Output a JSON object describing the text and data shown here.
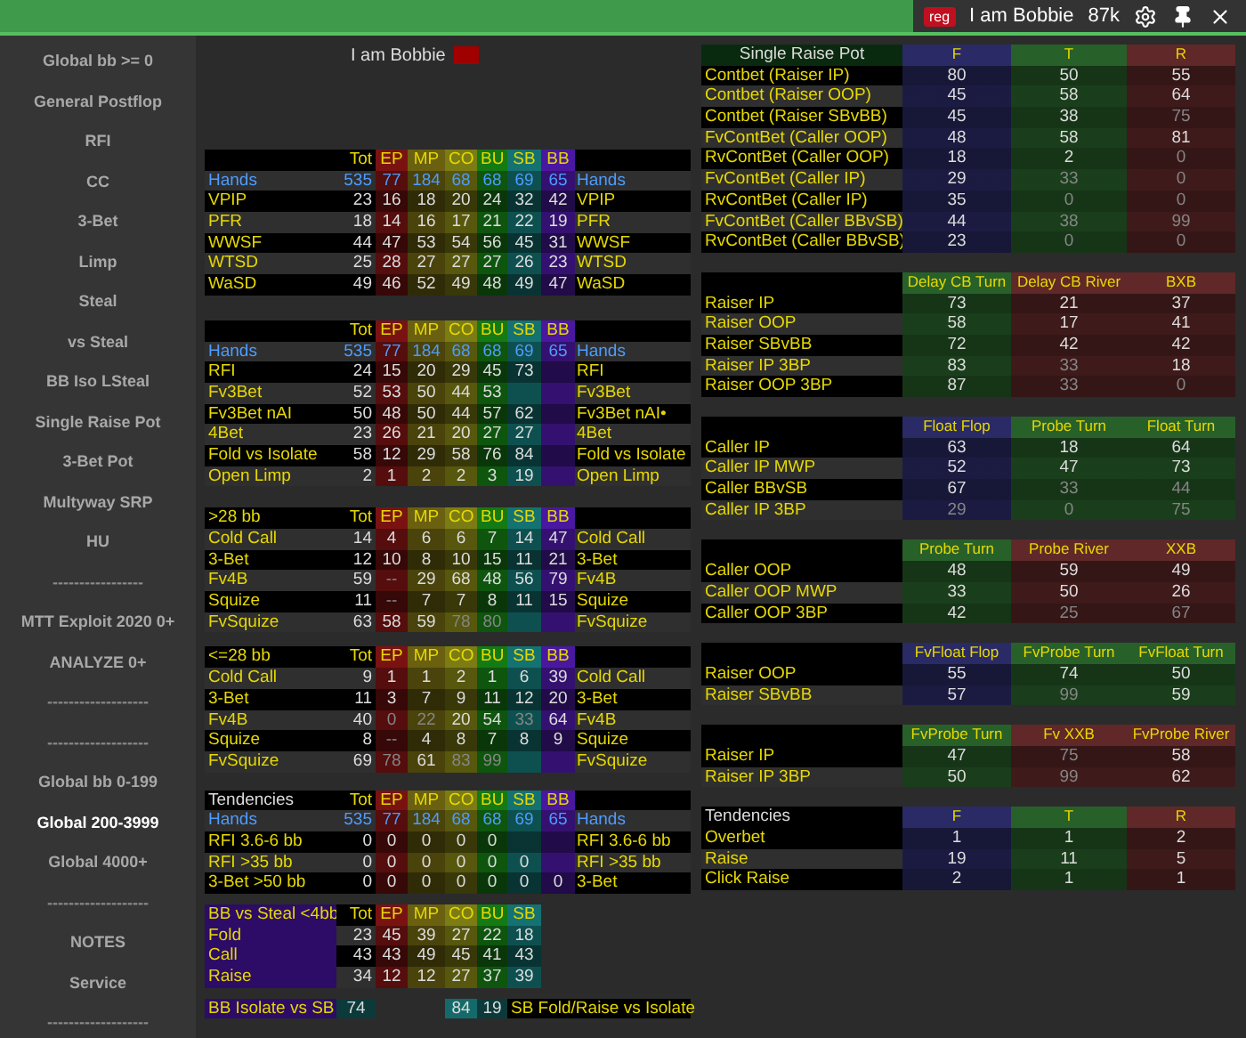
{
  "top_bar": {
    "badge": "reg",
    "user": "I am Bobbie",
    "count": "87k"
  },
  "sidebar": {
    "items": [
      {
        "label": "Global bb >= 0",
        "kind": "link",
        "selected": false
      },
      {
        "label": "General Postflop",
        "kind": "link",
        "selected": false
      },
      {
        "label": "RFI",
        "kind": "link",
        "selected": false
      },
      {
        "label": "CC",
        "kind": "link",
        "selected": false
      },
      {
        "label": "3-Bet",
        "kind": "link",
        "selected": false
      },
      {
        "label": "Limp",
        "kind": "link",
        "selected": false
      },
      {
        "label": "Steal",
        "kind": "link",
        "selected": false
      },
      {
        "label": "vs Steal",
        "kind": "link",
        "selected": false
      },
      {
        "label": "BB Iso LSteal",
        "kind": "link",
        "selected": false
      },
      {
        "label": "Single Raise Pot",
        "kind": "link",
        "selected": false
      },
      {
        "label": "3-Bet Pot",
        "kind": "link",
        "selected": false
      },
      {
        "label": "Multyway SRP",
        "kind": "link",
        "selected": false
      },
      {
        "label": "HU",
        "kind": "link",
        "selected": false
      },
      {
        "label": "-----------------",
        "kind": "divider",
        "selected": false
      },
      {
        "label": "MTT Exploit 2020 0+",
        "kind": "link",
        "selected": false
      },
      {
        "label": "ANALYZE 0+",
        "kind": "link",
        "selected": false
      },
      {
        "label": "-------------------",
        "kind": "divider",
        "selected": false
      },
      {
        "label": "-------------------",
        "kind": "divider",
        "selected": false
      },
      {
        "label": "Global bb 0-199",
        "kind": "link",
        "selected": false
      },
      {
        "label": "Global 200-3999",
        "kind": "link",
        "selected": true
      },
      {
        "label": "Global 4000+",
        "kind": "link",
        "selected": false
      },
      {
        "label": "-------------------",
        "kind": "divider",
        "selected": false
      },
      {
        "label": "NOTES",
        "kind": "link",
        "selected": false
      },
      {
        "label": "Service",
        "kind": "link",
        "selected": false
      },
      {
        "label": "-------------------",
        "kind": "divider",
        "selected": false
      }
    ]
  },
  "player_title": "I am Bobbie",
  "left_tables": [
    {
      "kind": "stats",
      "columns": [
        {
          "name": "Tot"
        },
        {
          "name": "EP",
          "color": "#7a1212"
        },
        {
          "name": "MP",
          "color": "#6a6010"
        },
        {
          "name": "CO",
          "color": "#7c7c14"
        },
        {
          "name": "BU",
          "color": "#147a14"
        },
        {
          "name": "SB",
          "color": "#147272"
        },
        {
          "name": "BB",
          "color": "#4a18a0"
        }
      ],
      "rows": [
        {
          "label": "Hands",
          "kind": "hands",
          "values": [
            "535",
            "77",
            "184",
            "68",
            "68",
            "69",
            "65"
          ],
          "right_label": "Hands"
        },
        {
          "label": "VPIP",
          "values": [
            "23",
            "16",
            "18",
            "20",
            "24",
            "32",
            "42"
          ],
          "right_label": "VPIP"
        },
        {
          "label": "PFR",
          "values": [
            "18",
            "14",
            "16",
            "17",
            "21",
            "22",
            "19"
          ],
          "right_label": "PFR"
        },
        {
          "label": "WWSF",
          "values": [
            "44",
            "47",
            "53",
            "54",
            "56",
            "45",
            "31"
          ],
          "right_label": "WWSF"
        },
        {
          "label": "WTSD",
          "values": [
            "25",
            "28",
            "27",
            "27",
            "27",
            "26",
            "23"
          ],
          "right_label": "WTSD"
        },
        {
          "label": "WaSD",
          "values": [
            "49",
            "46",
            "52",
            "49",
            "48",
            "49",
            "47"
          ],
          "right_label": "WaSD"
        }
      ]
    },
    {
      "kind": "stats",
      "columns": [
        {
          "name": "Tot"
        },
        {
          "name": "EP",
          "color": "#7a1212"
        },
        {
          "name": "MP",
          "color": "#6a6010"
        },
        {
          "name": "CO",
          "color": "#7c7c14"
        },
        {
          "name": "BU",
          "color": "#147a14"
        },
        {
          "name": "SB",
          "color": "#147272"
        },
        {
          "name": "BB",
          "color": "#4a18a0"
        }
      ],
      "rows": [
        {
          "label": "Hands",
          "kind": "hands",
          "values": [
            "535",
            "77",
            "184",
            "68",
            "68",
            "69",
            "65"
          ],
          "right_label": "Hands"
        },
        {
          "label": "RFI",
          "values": [
            "24",
            "15",
            "20",
            "29",
            "45",
            "73"
          ],
          "right_label": "RFI"
        },
        {
          "label": "Fv3Bet",
          "values": [
            "52",
            "53",
            "50",
            "44",
            "53"
          ],
          "right_label": "Fv3Bet"
        },
        {
          "label": "Fv3Bet nAI",
          "values": [
            "50",
            "48",
            "50",
            "44",
            "57",
            "62"
          ],
          "right_label": "Fv3Bet nAI•"
        },
        {
          "label": "4Bet",
          "values": [
            "23",
            "26",
            "21",
            "20",
            "27",
            "27"
          ],
          "right_label": "4Bet"
        },
        {
          "label": "Fold vs Isolate",
          "values": [
            "58",
            "12",
            "29",
            "58",
            "76",
            "84"
          ],
          "right_label": "Fold vs Isolate"
        },
        {
          "label": "Open Limp",
          "values": [
            "2",
            "1",
            "2",
            "2",
            "3",
            "19"
          ],
          "right_label": "Open Limp"
        }
      ]
    },
    {
      "kind": "stats",
      "title": ">28 bb",
      "columns": [
        {
          "name": "Tot"
        },
        {
          "name": "EP",
          "color": "#7a1212"
        },
        {
          "name": "MP",
          "color": "#6a6010"
        },
        {
          "name": "CO",
          "color": "#7c7c14"
        },
        {
          "name": "BU",
          "color": "#147a14"
        },
        {
          "name": "SB",
          "color": "#147272"
        },
        {
          "name": "BB",
          "color": "#4a18a0"
        }
      ],
      "rows": [
        {
          "label": "Cold Call",
          "values": [
            "14",
            "4",
            "6",
            "6",
            "7",
            "14",
            "47"
          ],
          "right_label": "Cold Call"
        },
        {
          "label": "3-Bet",
          "values": [
            "12",
            "10",
            "8",
            "10",
            "15",
            "11",
            "21"
          ],
          "right_label": "3-Bet"
        },
        {
          "label": "Fv4B",
          "values": [
            "59",
            "--",
            "29",
            "68",
            "48",
            "56",
            "79"
          ],
          "right_label": "Fv4B",
          "dimmed": [
            false,
            true,
            false,
            false,
            false,
            false,
            false
          ]
        },
        {
          "label": "Squize",
          "values": [
            "11",
            "--",
            "7",
            "7",
            "8",
            "11",
            "15"
          ],
          "right_label": "Squize",
          "dimmed": [
            false,
            true,
            false,
            false,
            false,
            false,
            false
          ]
        },
        {
          "label": "FvSquize",
          "values": [
            "63",
            "58",
            "59",
            "78",
            "80"
          ],
          "right_label": "FvSquize",
          "dimmed": [
            false,
            false,
            false,
            true,
            true
          ]
        }
      ]
    },
    {
      "kind": "stats",
      "title": "<=28 bb",
      "columns": [
        {
          "name": "Tot"
        },
        {
          "name": "EP",
          "color": "#7a1212"
        },
        {
          "name": "MP",
          "color": "#6a6010"
        },
        {
          "name": "CO",
          "color": "#7c7c14"
        },
        {
          "name": "BU",
          "color": "#147a14"
        },
        {
          "name": "SB",
          "color": "#147272"
        },
        {
          "name": "BB",
          "color": "#4a18a0"
        }
      ],
      "rows": [
        {
          "label": "Cold Call",
          "values": [
            "9",
            "1",
            "1",
            "2",
            "1",
            "6",
            "39"
          ],
          "right_label": "Cold Call"
        },
        {
          "label": "3-Bet",
          "values": [
            "11",
            "3",
            "7",
            "9",
            "11",
            "12",
            "20"
          ],
          "right_label": "3-Bet"
        },
        {
          "label": "Fv4B",
          "values": [
            "40",
            "0",
            "22",
            "20",
            "54",
            "33",
            "64"
          ],
          "right_label": "Fv4B",
          "dimmed": [
            false,
            true,
            true,
            false,
            false,
            true,
            false
          ]
        },
        {
          "label": "Squize",
          "values": [
            "8",
            "--",
            "4",
            "8",
            "7",
            "8",
            "9"
          ],
          "right_label": "Squize",
          "dimmed": [
            false,
            true,
            false,
            false,
            false,
            false,
            false
          ]
        },
        {
          "label": "FvSquize",
          "values": [
            "69",
            "78",
            "61",
            "83",
            "99"
          ],
          "right_label": "FvSquize",
          "dimmed": [
            false,
            true,
            false,
            true,
            true
          ]
        }
      ]
    },
    {
      "kind": "tendencies",
      "title": "Tendencies",
      "columns": [
        {
          "name": "Tot"
        },
        {
          "name": "EP",
          "color": "#7a1212"
        },
        {
          "name": "MP",
          "color": "#6a6010"
        },
        {
          "name": "CO",
          "color": "#7c7c14"
        },
        {
          "name": "BU",
          "color": "#147a14"
        },
        {
          "name": "SB",
          "color": "#147272"
        },
        {
          "name": "BB",
          "color": "#4a18a0"
        }
      ],
      "rows": [
        {
          "label": "Hands",
          "kind": "hands",
          "values": [
            "535",
            "77",
            "184",
            "68",
            "68",
            "69",
            "65"
          ],
          "right_label": "Hands"
        },
        {
          "label": "RFI 3.6-6 bb",
          "values": [
            "0",
            "0",
            "0",
            "0",
            "0"
          ],
          "right_label": "RFI 3.6-6 bb"
        },
        {
          "label": "RFI >35 bb",
          "values": [
            "0",
            "0",
            "0",
            "0",
            "0",
            "0"
          ],
          "right_label": "RFI >35 bb"
        },
        {
          "label": "3-Bet >50 bb",
          "values": [
            "0",
            "0",
            "0",
            "0",
            "0",
            "0",
            "0"
          ],
          "right_label": "3-Bet"
        }
      ]
    },
    {
      "kind": "steal",
      "title": "BB vs Steal <4bb",
      "columns": [
        {
          "name": "Tot"
        },
        {
          "name": "EP",
          "color": "#7a1212"
        },
        {
          "name": "MP",
          "color": "#6a6010"
        },
        {
          "name": "CO",
          "color": "#7c7c14"
        },
        {
          "name": "BU",
          "color": "#147a14"
        },
        {
          "name": "SB",
          "color": "#147272"
        }
      ],
      "rows": [
        {
          "label": "Fold",
          "values": [
            "23",
            "45",
            "39",
            "27",
            "22",
            "18"
          ]
        },
        {
          "label": "Call",
          "values": [
            "43",
            "43",
            "49",
            "45",
            "41",
            "43"
          ]
        },
        {
          "label": "Raise",
          "values": [
            "34",
            "12",
            "12",
            "27",
            "37",
            "39"
          ]
        }
      ]
    }
  ],
  "isolate_row": {
    "bb_label": "BB Isolate vs SB",
    "bb_value": "74",
    "sb_values": [
      "84",
      "19"
    ],
    "sb_label": "SB Fold/Raise vs Isolate"
  },
  "right_tables": [
    {
      "kind": "srp",
      "title": "Single Raise Pot",
      "columns": [
        {
          "name": "F",
          "color": "#2a2a66"
        },
        {
          "name": "T",
          "color": "#28602a"
        },
        {
          "name": "R",
          "color": "#602828"
        }
      ],
      "rows": [
        {
          "label": "Contbet (Raiser IP)",
          "values": [
            "80",
            "50",
            "55"
          ]
        },
        {
          "label": "Contbet (Raiser OOP)",
          "values": [
            "45",
            "58",
            "64"
          ]
        },
        {
          "label": "Contbet (Raiser SBvBB)",
          "values": [
            "45",
            "38",
            "75"
          ],
          "dimmed": [
            false,
            false,
            true
          ]
        },
        {
          "label": "FvContBet (Caller OOP)",
          "values": [
            "48",
            "58",
            "81"
          ]
        },
        {
          "label": "RvContBet (Caller OOP)",
          "values": [
            "18",
            "2",
            "0"
          ],
          "dimmed": [
            false,
            false,
            true
          ]
        },
        {
          "label": "FvContBet (Caller IP)",
          "values": [
            "29",
            "33",
            "0"
          ],
          "dimmed": [
            false,
            true,
            true
          ]
        },
        {
          "label": "RvContBet (Caller IP)",
          "values": [
            "35",
            "0",
            "0"
          ],
          "dimmed": [
            false,
            true,
            true
          ]
        },
        {
          "label": "FvContBet (Caller BBvSB)",
          "values": [
            "44",
            "38",
            "99"
          ],
          "dimmed": [
            false,
            true,
            true
          ]
        },
        {
          "label": "RvContBet (Caller BBvSB)",
          "values": [
            "23",
            "0",
            "0"
          ],
          "dimmed": [
            false,
            true,
            true
          ]
        }
      ]
    },
    {
      "kind": "split",
      "columns": [
        {
          "name": "Delay CB Turn",
          "color": "#28602a"
        },
        {
          "name": "Delay CB River",
          "color": "#602828"
        },
        {
          "name": "BXB",
          "color": "#602828"
        }
      ],
      "rows": [
        {
          "label": "Raiser IP",
          "values": [
            "73",
            "21",
            "37"
          ]
        },
        {
          "label": "Raiser OOP",
          "values": [
            "58",
            "17",
            "41"
          ]
        },
        {
          "label": "Raiser SBvBB",
          "values": [
            "72",
            "42",
            "42"
          ]
        },
        {
          "label": "Raiser IP 3BP",
          "values": [
            "83",
            "33",
            "18"
          ],
          "dimmed": [
            false,
            true,
            false
          ]
        },
        {
          "label": "Raiser OOP 3BP",
          "values": [
            "87",
            "33",
            "0"
          ],
          "dimmed": [
            false,
            true,
            true
          ]
        }
      ]
    },
    {
      "kind": "split",
      "columns": [
        {
          "name": "Float Flop",
          "color": "#2a2a66"
        },
        {
          "name": "Probe Turn",
          "color": "#28602a"
        },
        {
          "name": "Float Turn",
          "color": "#28602a"
        }
      ],
      "rows": [
        {
          "label": "Caller IP",
          "values": [
            "63",
            "18",
            "64"
          ]
        },
        {
          "label": "Caller IP MWP",
          "values": [
            "52",
            "47",
            "73"
          ]
        },
        {
          "label": "Caller BBvSB",
          "values": [
            "67",
            "33",
            "44"
          ],
          "dimmed": [
            false,
            true,
            true
          ]
        },
        {
          "label": "Caller IP 3BP",
          "values": [
            "29",
            "0",
            "75"
          ],
          "dimmed": [
            true,
            true,
            true
          ]
        }
      ]
    },
    {
      "kind": "split",
      "columns": [
        {
          "name": "Probe Turn",
          "color": "#28602a"
        },
        {
          "name": "Probe River",
          "color": "#602828"
        },
        {
          "name": "XXB",
          "color": "#602828"
        }
      ],
      "rows": [
        {
          "label": "Caller OOP",
          "values": [
            "48",
            "59",
            "49"
          ]
        },
        {
          "label": "Caller OOP MWP",
          "values": [
            "33",
            "50",
            "26"
          ]
        },
        {
          "label": "Caller OOP 3BP",
          "values": [
            "42",
            "25",
            "67"
          ],
          "dimmed": [
            false,
            true,
            true
          ]
        }
      ]
    },
    {
      "kind": "split",
      "columns": [
        {
          "name": "FvFloat Flop",
          "color": "#2a2a66"
        },
        {
          "name": "FvProbe Turn",
          "color": "#28602a"
        },
        {
          "name": "FvFloat Turn",
          "color": "#28602a"
        }
      ],
      "rows": [
        {
          "label": "Raiser OOP",
          "values": [
            "55",
            "74",
            "50"
          ]
        },
        {
          "label": "Raiser SBvBB",
          "values": [
            "57",
            "99",
            "59"
          ],
          "dimmed": [
            false,
            true,
            false
          ]
        }
      ]
    },
    {
      "kind": "split",
      "columns": [
        {
          "name": "FvProbe Turn",
          "color": "#28602a"
        },
        {
          "name": "Fv XXB",
          "color": "#602828"
        },
        {
          "name": "FvProbe River",
          "color": "#602828"
        }
      ],
      "rows": [
        {
          "label": "Raiser IP",
          "values": [
            "47",
            "75",
            "58"
          ],
          "dimmed": [
            false,
            true,
            false
          ]
        },
        {
          "label": "Raiser IP 3BP",
          "values": [
            "50",
            "99",
            "62"
          ],
          "dimmed": [
            false,
            true,
            false
          ]
        }
      ]
    },
    {
      "kind": "tendencies",
      "title": "Tendencies",
      "columns": [
        {
          "name": "F",
          "color": "#2a2a66"
        },
        {
          "name": "T",
          "color": "#28602a"
        },
        {
          "name": "R",
          "color": "#602828"
        }
      ],
      "rows": [
        {
          "label": "Overbet",
          "values": [
            "1",
            "1",
            "2"
          ]
        },
        {
          "label": "Raise",
          "values": [
            "19",
            "11",
            "5"
          ]
        },
        {
          "label": "Click Raise",
          "values": [
            "2",
            "1",
            "1"
          ]
        }
      ]
    }
  ]
}
